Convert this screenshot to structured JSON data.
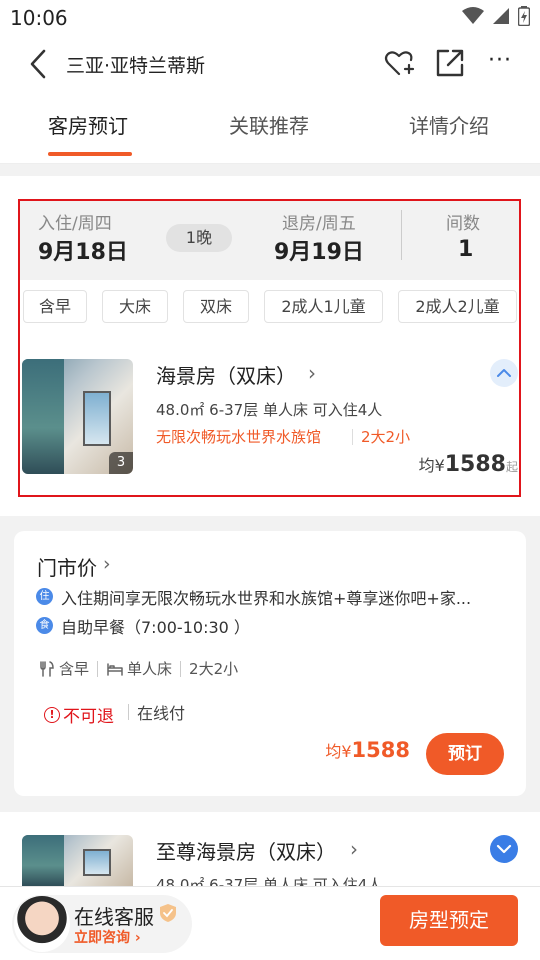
{
  "status_bar": {
    "time": "10:06",
    "icons": [
      "wifi-icon",
      "signal-icon",
      "battery-icon"
    ]
  },
  "header": {
    "title": "三亚·亚特兰蒂斯",
    "icons": [
      "back-icon",
      "favorite-add-icon",
      "share-icon",
      "more-icon"
    ],
    "more_label": "···"
  },
  "tabs": [
    {
      "label": "客房预订",
      "active": true
    },
    {
      "label": "关联推荐",
      "active": false
    },
    {
      "label": "详情介绍",
      "active": false
    }
  ],
  "dates": {
    "checkin_label": "入住/周四",
    "checkin_date": "9月18日",
    "nights": "1晚",
    "checkout_label": "退房/周五",
    "checkout_date": "9月19日",
    "rooms_label": "间数",
    "rooms_count": "1"
  },
  "filters": [
    "含早",
    "大床",
    "双床",
    "2成人1儿童",
    "2成人2儿童"
  ],
  "room1": {
    "name": "海景房（双床）",
    "chevron": "›",
    "image_count": "3",
    "specs": "48.0㎡ 6-37层 单人床 可入住4人",
    "tag": "无限次畅玩水世界水族馆",
    "occupancy": "2大2小",
    "price_prefix": "均¥",
    "price": "1588",
    "price_suffix": "起"
  },
  "rate_card": {
    "title": "门市价",
    "chevron": "›",
    "benefit1_icon_char": "住",
    "benefit1": "入住期间享无限次畅玩水世界和水族馆+尊享迷你吧+家...",
    "benefit2_icon_char": "食",
    "benefit2": "自助早餐（7:00-10:30 ）",
    "facilities": [
      "含早",
      "单人床",
      "2大2小"
    ],
    "policy_icon_char": "!",
    "cancel_policy": "不可退",
    "payment": "在线付",
    "price_prefix": "均¥",
    "price": "1588",
    "book_label": "预订"
  },
  "room2": {
    "name": "至尊海景房（双床）",
    "chevron": "›",
    "specs": "48.0㎡ 6-37层 单人床 可入住4人"
  },
  "bottom_bar": {
    "cs_label": "在线客服",
    "cs_link": "立即咨询",
    "cs_link_arrow": "›",
    "reserve_label": "房型预定"
  },
  "colors": {
    "accent": "#f05a28",
    "highlight_box": "#e0151b",
    "info_blue": "#4b8ae8",
    "warning_red": "#e0151b"
  }
}
